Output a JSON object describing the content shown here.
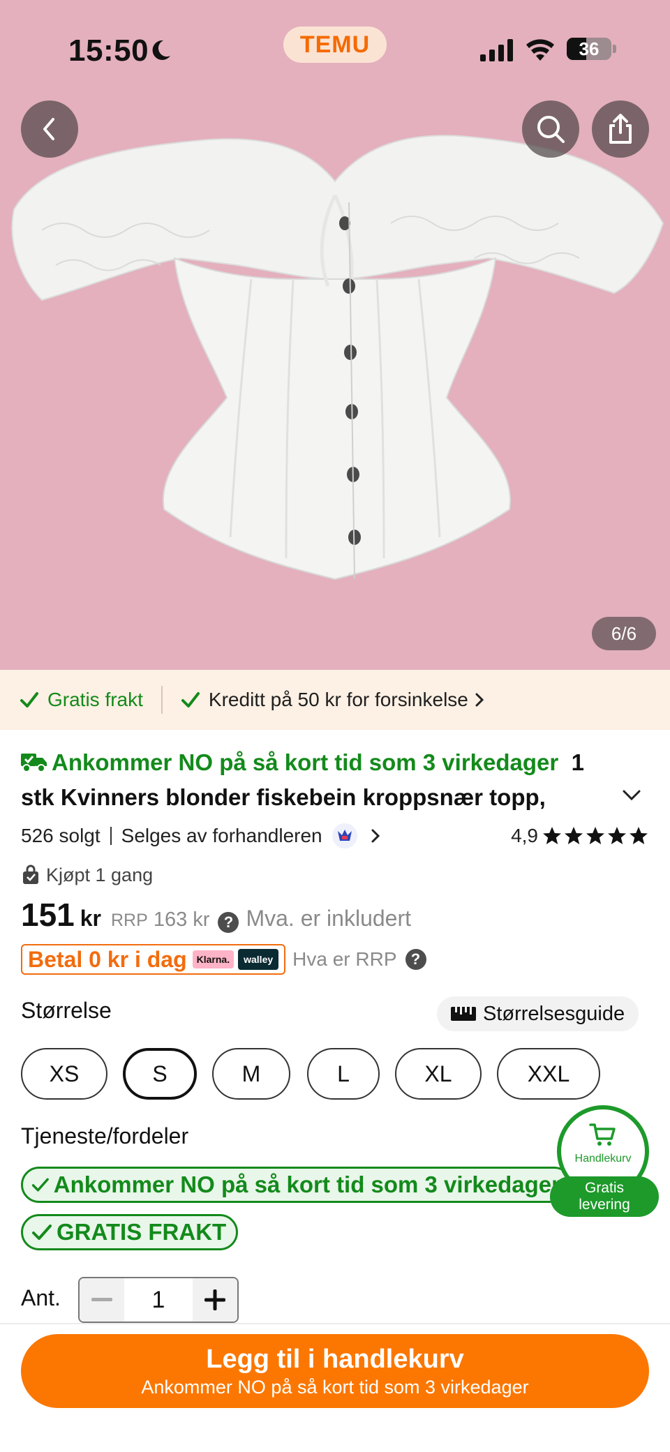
{
  "status_bar": {
    "time": "15:50",
    "app_name": "TEMU",
    "battery": "36"
  },
  "gallery": {
    "counter": "6/6",
    "background_color": "#e4b0bd"
  },
  "benefit_strip": {
    "free_shipping": "Gratis frakt",
    "credit": "Kreditt på 50 kr for forsinkelse"
  },
  "product": {
    "delivery_promo": "Ankommer NO på så kort tid som 3 virkedager",
    "title_line1_rest": "1",
    "title_line2": "stk Kvinners blonder fiskebein kroppsnær topp,",
    "sold": "526 solgt",
    "seller": "Selges av forhandleren",
    "rating": "4,9",
    "stars": 5,
    "bought": "Kjøpt 1 gang",
    "price": "151",
    "currency": "kr",
    "rrp_label": "RRP",
    "rrp_value": "163 kr",
    "vat_note": "Mva. er inkludert",
    "pay_later": "Betal 0 kr i dag",
    "klarna": "Klarna.",
    "walley": "walley",
    "rrp_help": "Hva er RRP"
  },
  "size": {
    "heading": "Størrelse",
    "guide_label": "Størrelsesguide",
    "options": [
      "XS",
      "S",
      "M",
      "L",
      "XL",
      "XXL"
    ],
    "selected": "S"
  },
  "services": {
    "heading": "Tjeneste/fordeler",
    "items": [
      "Ankommer NO på så kort tid som 3 virkedager",
      "GRATIS FRAKT"
    ]
  },
  "quantity": {
    "label": "Ant.",
    "value": "1"
  },
  "cart_float": {
    "label": "Handlekurv",
    "badge_line1": "Gratis",
    "badge_line2": "levering"
  },
  "cta": {
    "main": "Legg til i handlekurv",
    "sub": "Ankommer NO på så kort tid som 3 virkedager"
  },
  "colors": {
    "accent_orange": "#fb7701",
    "green": "#138a1b",
    "strip_bg": "#fdf0e4"
  }
}
